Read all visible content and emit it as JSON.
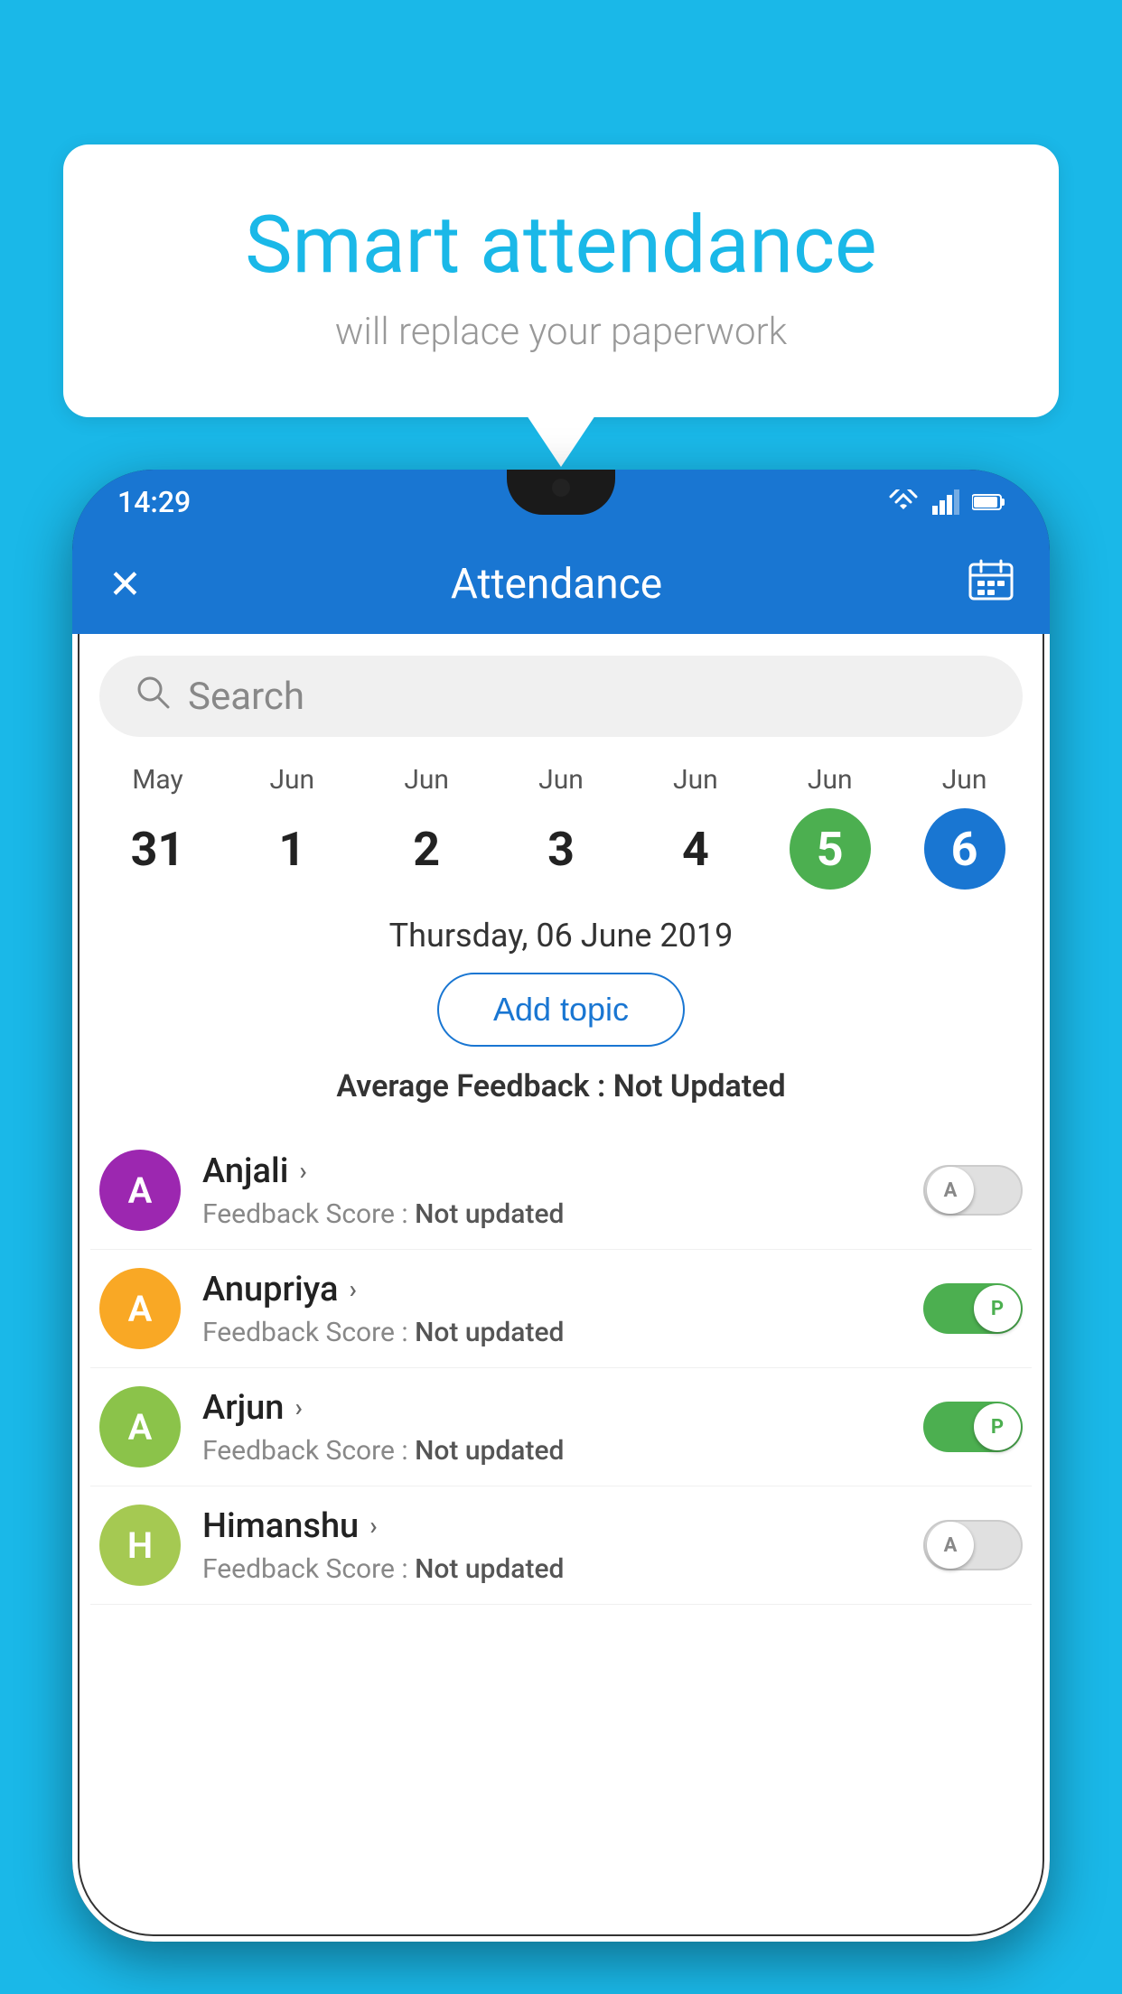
{
  "background": {
    "color": "#1ab8e8"
  },
  "speech_bubble": {
    "title": "Smart attendance",
    "subtitle": "will replace your paperwork"
  },
  "status_bar": {
    "time": "14:29",
    "wifi": "▲",
    "signal": "▲",
    "battery": "▌"
  },
  "app_bar": {
    "close_label": "✕",
    "title": "Attendance",
    "calendar_icon": "📅"
  },
  "search": {
    "placeholder": "Search"
  },
  "calendar": {
    "days": [
      {
        "month": "May",
        "date": "31",
        "style": "normal"
      },
      {
        "month": "Jun",
        "date": "1",
        "style": "normal"
      },
      {
        "month": "Jun",
        "date": "2",
        "style": "normal"
      },
      {
        "month": "Jun",
        "date": "3",
        "style": "normal"
      },
      {
        "month": "Jun",
        "date": "4",
        "style": "normal"
      },
      {
        "month": "Jun",
        "date": "5",
        "style": "today"
      },
      {
        "month": "Jun",
        "date": "6",
        "style": "selected"
      }
    ]
  },
  "selected_date_label": "Thursday, 06 June 2019",
  "add_topic_label": "Add topic",
  "average_feedback": {
    "label": "Average Feedback : ",
    "value": "Not Updated"
  },
  "students": [
    {
      "name": "Anjali",
      "avatar_letter": "A",
      "avatar_color": "#9c27b0",
      "feedback_label": "Feedback Score : ",
      "feedback_value": "Not updated",
      "toggle_state": "off",
      "toggle_label": "A"
    },
    {
      "name": "Anupriya",
      "avatar_letter": "A",
      "avatar_color": "#f9a825",
      "feedback_label": "Feedback Score : ",
      "feedback_value": "Not updated",
      "toggle_state": "on",
      "toggle_label": "P"
    },
    {
      "name": "Arjun",
      "avatar_letter": "A",
      "avatar_color": "#8bc34a",
      "feedback_label": "Feedback Score : ",
      "feedback_value": "Not updated",
      "toggle_state": "on",
      "toggle_label": "P"
    },
    {
      "name": "Himanshu",
      "avatar_letter": "H",
      "avatar_color": "#a5c952",
      "feedback_label": "Feedback Score : ",
      "feedback_value": "Not updated",
      "toggle_state": "off",
      "toggle_label": "A"
    }
  ]
}
